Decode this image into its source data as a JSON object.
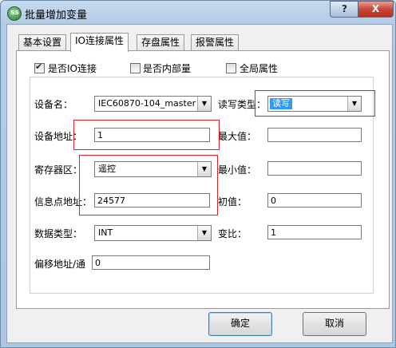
{
  "window": {
    "title": "批量增加变量",
    "help_label": "?",
    "close_label": "X",
    "icon_text": "ss"
  },
  "tabs": [
    {
      "label": "基本设置"
    },
    {
      "label": "IO连接属性"
    },
    {
      "label": "存盘属性"
    },
    {
      "label": "报警属性"
    }
  ],
  "checkboxes": {
    "io_connect": {
      "label": "是否IO连接",
      "checked": true
    },
    "internal": {
      "label": "是否内部量",
      "checked": false
    },
    "global": {
      "label": "全局属性",
      "checked": false
    }
  },
  "fields": {
    "device_name": {
      "label": "设备名：",
      "value": "IEC60870-104_master"
    },
    "device_addr": {
      "label": "设备地址：",
      "value": "1"
    },
    "register": {
      "label": "寄存器区：",
      "value": "遥控"
    },
    "info_addr": {
      "label": "信息点地址：",
      "value": "24577"
    },
    "data_type": {
      "label": "数据类型：",
      "value": "INT"
    },
    "offset": {
      "label": "偏移地址/通",
      "value": "0"
    },
    "rw_type": {
      "label": "读写类型：",
      "value": "读写"
    },
    "max_value": {
      "label": "最大值：",
      "value": ""
    },
    "min_value": {
      "label": "最小值：",
      "value": ""
    },
    "init_value": {
      "label": "初值：",
      "value": "0"
    },
    "ratio": {
      "label": "变比：",
      "value": "1"
    }
  },
  "buttons": {
    "ok": "确定",
    "cancel": "取消"
  }
}
